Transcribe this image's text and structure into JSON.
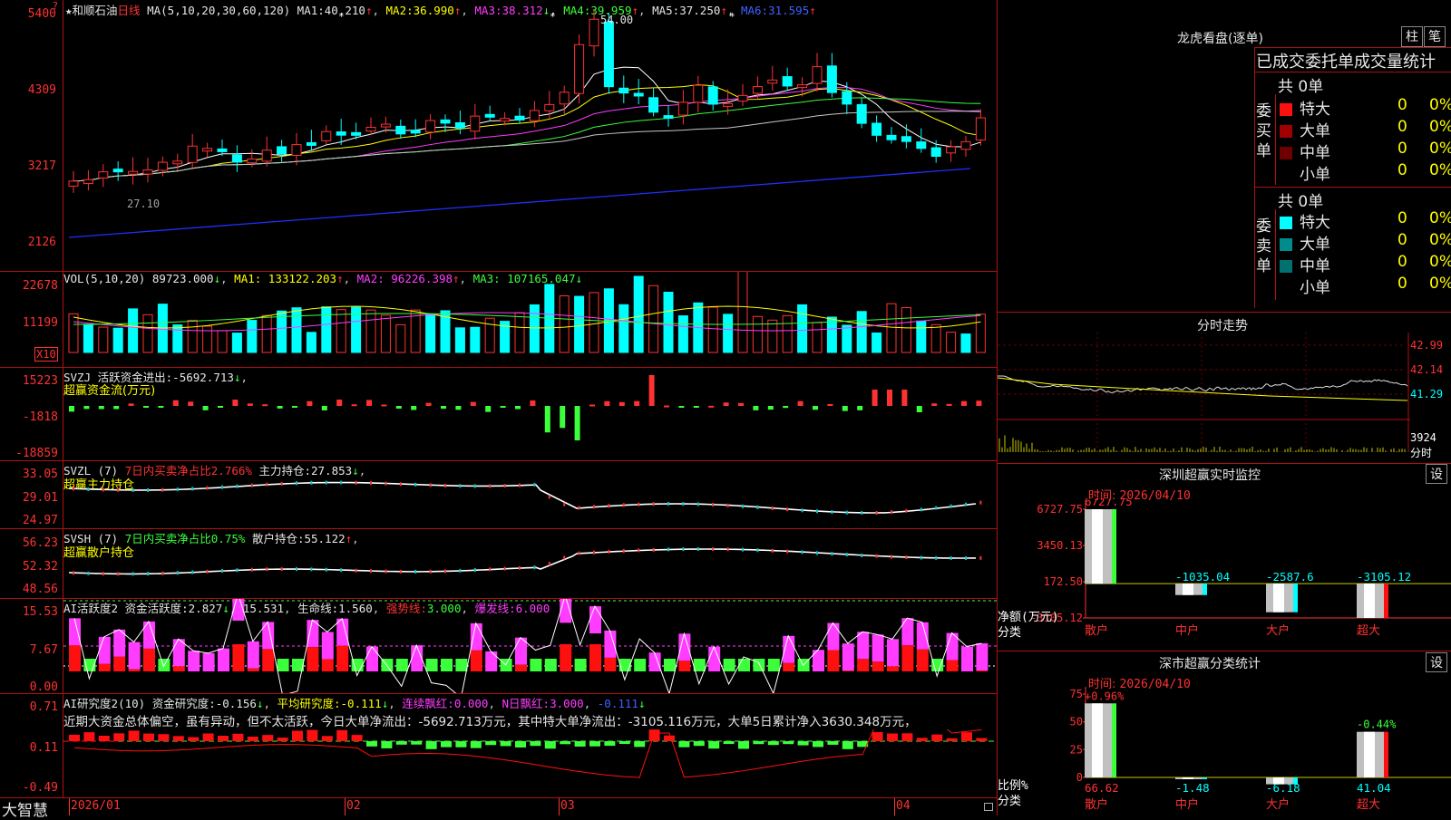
{
  "app": {
    "brand": "大智慧",
    "stock_name": "和顺石油",
    "period": "日线",
    "star": "★"
  },
  "colors": {
    "up": "#ff3232",
    "down": "#00ffff",
    "ma1": "#ffffff",
    "ma2": "#ffff00",
    "ma3": "#ff3cff",
    "ma4": "#3cff3c",
    "ma5": "#c8c8c8",
    "ma6": "#2030ff",
    "border": "#b01010"
  },
  "main_chart": {
    "ma_header": "MA(5,10,20,30,60,120)",
    "ma": [
      {
        "label": "MA1:",
        "value": "40.210",
        "arrow": "↑"
      },
      {
        "label": "MA2:",
        "value": "36.990",
        "arrow": "↑"
      },
      {
        "label": "MA3:",
        "value": "38.312",
        "arrow": "↓"
      },
      {
        "label": "MA4:",
        "value": "39.959",
        "arrow": "↑"
      },
      {
        "label": "MA5:",
        "value": "37.250",
        "arrow": "↑"
      },
      {
        "label": "MA6:",
        "value": "31.595",
        "arrow": "↑"
      }
    ],
    "yticks": [
      "5400",
      "4309",
      "3217",
      "2126"
    ],
    "high_label": "54.00",
    "low_label": "27.10",
    "top_marker": "?"
  },
  "vol": {
    "header": "VOL(5,10,20)",
    "value": "89723.000",
    "arrow": "↓",
    "ma1": "MA1: 133122.203",
    "ma1_arrow": "↑",
    "ma2": "MA2: 96226.398",
    "ma2_arrow": "↑",
    "ma3": "MA3: 107165.047",
    "ma3_arrow": "↓",
    "yticks": [
      "22678",
      "11199"
    ],
    "unit": "X10"
  },
  "svzj": {
    "header": "SVZJ",
    "label1": "活跃资金进出:",
    "value": "-5692.713",
    "arrow": "↓",
    "sub": "超赢资金流(万元)",
    "yticks": [
      "15223",
      "-1818",
      "-18859"
    ]
  },
  "svzl": {
    "header": "SVZL (7)",
    "label1": "7日内买卖净占比2.766%",
    "label2": "主力持仓:",
    "value": "27.853",
    "arrow": "↓",
    "sub": "超赢主力持仓",
    "yticks": [
      "33.05",
      "29.01",
      "24.97"
    ]
  },
  "svsh": {
    "header": "SVSH (7)",
    "label1": "7日内买卖净占比0.75%",
    "label2": "散户持仓:",
    "value": "55.122",
    "arrow": "↑",
    "sub": "超赢散户持仓",
    "yticks": [
      "56.23",
      "52.32",
      "48.56"
    ]
  },
  "ai1": {
    "header": "AI活跃度2",
    "label1": "资金活跃度:",
    "value1": "2.827",
    "arrow1": "↓",
    "value2": "15.531",
    "label3": "生命线:",
    "value3": "1.560",
    "label4": "强势线:",
    "value4": "3.000",
    "label5": "爆发线:",
    "value5": "6.000",
    "yticks": [
      "15.53",
      "7.67",
      "0.00"
    ]
  },
  "ai2": {
    "header": "AI研究度2(10)",
    "label1": "资金研究度:",
    "value1": "-0.156",
    "arrow1": "↓",
    "label2": "平均研究度:",
    "value2": "-0.111",
    "arrow2": "↓",
    "label3": "连续飘红:",
    "value3": "0.000",
    "label4": "N日飘红:",
    "value4": "3.000",
    "value5": "-0.111",
    "arrow5": "↓",
    "comment": "近期大资金总体偏空，虽有异动，但不太活跃，今日大单净流出：-5692.713万元，其中特大单净流出：-3105.116万元，大单5日累计净入3630.348万元，",
    "yticks": [
      "0.71",
      "0.11",
      "-0.49"
    ]
  },
  "xaxis": [
    "2026/01",
    "02",
    "03",
    "04"
  ],
  "right": {
    "lhb": {
      "title": "龙虎看盘(逐单)",
      "btn1": "柱",
      "btn2": "笔",
      "subtitle": "已成交委托单成交量统计",
      "buy": {
        "side": "委买单",
        "total": "共 0单",
        "rows": [
          {
            "name": "特大",
            "val": "0",
            "pct": "0%",
            "color": "#ff1010"
          },
          {
            "name": "大单",
            "val": "0",
            "pct": "0%",
            "color": "#a00000"
          },
          {
            "name": "中单",
            "val": "0",
            "pct": "0%",
            "color": "#700000"
          },
          {
            "name": "小单",
            "val": "0",
            "pct": "0%",
            "color": ""
          }
        ]
      },
      "sell": {
        "side": "委卖单",
        "total": "共 0单",
        "rows": [
          {
            "name": "特大",
            "val": "0",
            "pct": "0%",
            "color": "#00ffff"
          },
          {
            "name": "大单",
            "val": "0",
            "pct": "0%",
            "color": "#008c8c"
          },
          {
            "name": "中单",
            "val": "0",
            "pct": "0%",
            "color": "#007070"
          },
          {
            "name": "小单",
            "val": "0",
            "pct": "0%",
            "color": ""
          }
        ]
      }
    },
    "fenshi": {
      "title": "分时走势",
      "ticks": [
        "42.99",
        "42.14",
        "41.29",
        "3924"
      ],
      "bottom": "分时"
    },
    "szcy": {
      "title": "深圳超赢实时监控",
      "btn": "设",
      "time_label": "时间:",
      "time": "2026/04/10",
      "yticks": [
        "6727.75",
        "3450.13",
        "172.50",
        "-3105.12"
      ],
      "ylabel": "净额(万元)",
      "xlabel": "分类",
      "bars": [
        {
          "cat": "散户",
          "value": 6727.75,
          "label": "6727.75"
        },
        {
          "cat": "中户",
          "value": -1035.04,
          "label": "-1035.04"
        },
        {
          "cat": "大户",
          "value": -2587.6,
          "label": "-2587.6"
        },
        {
          "cat": "超大",
          "value": -3105.12,
          "label": "-3105.12"
        }
      ]
    },
    "fenlei": {
      "title": "深市超赢分类统计",
      "btn": "设",
      "time_label": "时间:",
      "time": "2026/04/10",
      "yticks": [
        "75",
        "50",
        "25",
        "0"
      ],
      "ylabel": "比例%",
      "xlabel": "分类",
      "bars": [
        {
          "cat": "散户",
          "value": 66.62,
          "label": "66.62",
          "top": "+0.96%"
        },
        {
          "cat": "中户",
          "value": -1.48,
          "label": "-1.48",
          "top": ""
        },
        {
          "cat": "大户",
          "value": -6.18,
          "label": "-6.18",
          "top": ""
        },
        {
          "cat": "超大",
          "value": 41.04,
          "label": "41.04",
          "top": "-0.44%"
        }
      ]
    }
  }
}
